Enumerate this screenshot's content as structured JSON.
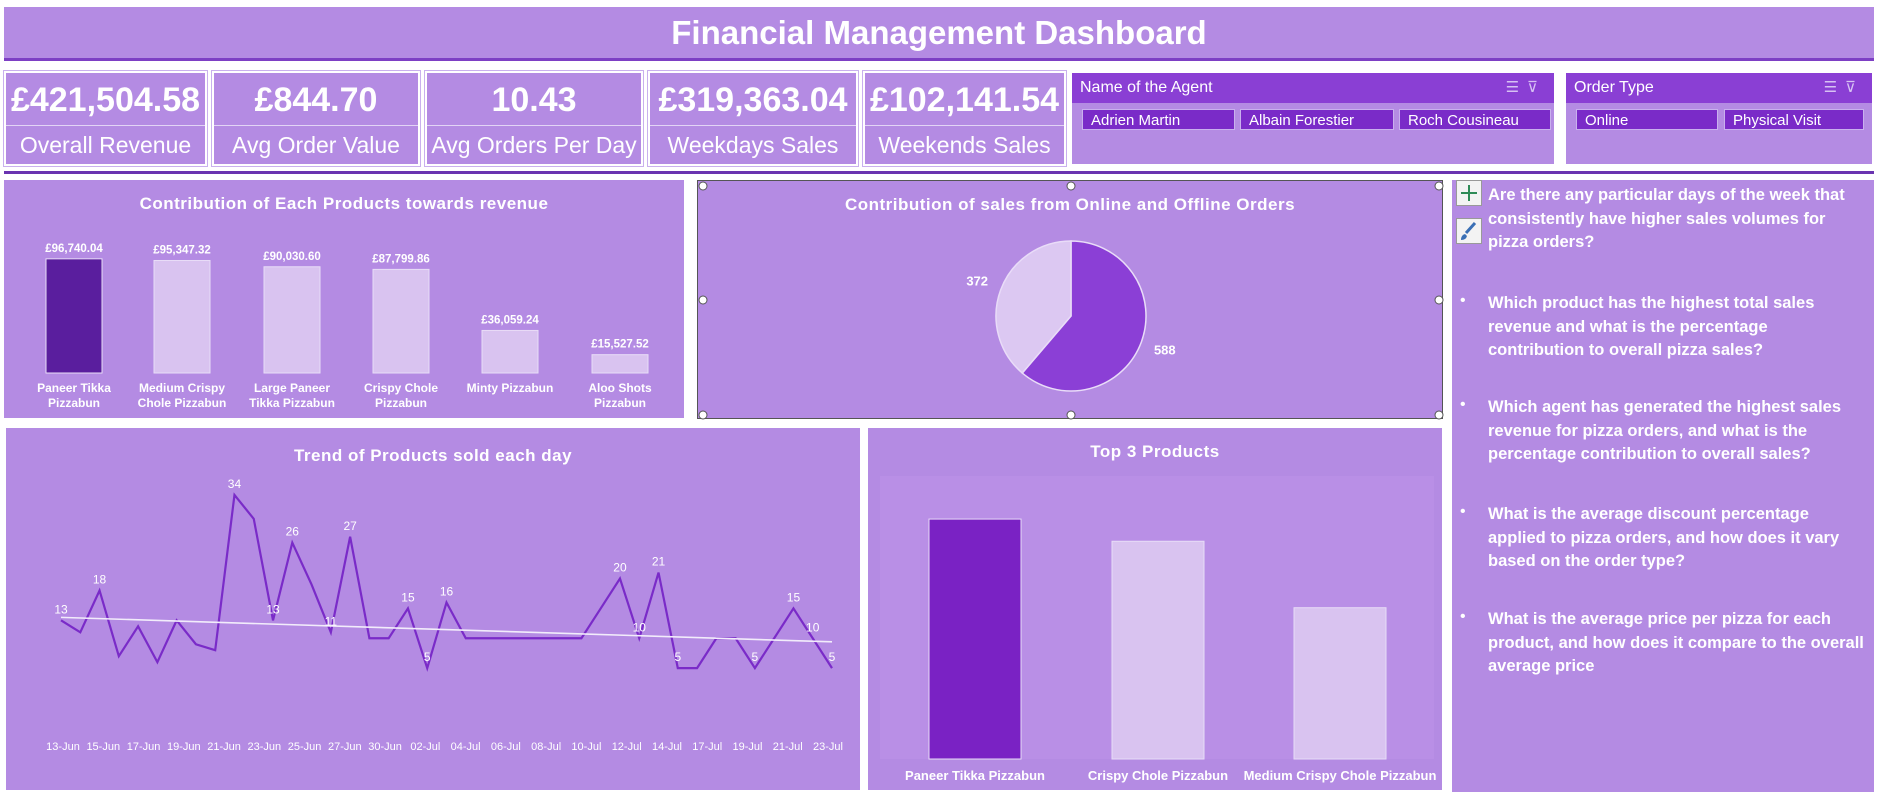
{
  "header": {
    "title": "Financial Management Dashboard"
  },
  "kpis": [
    {
      "value": "£421,504.58",
      "label": "Overall Revenue"
    },
    {
      "value": "£844.70",
      "label": "Avg Order Value"
    },
    {
      "value": "10.43",
      "label": "Avg Orders Per Day"
    },
    {
      "value": "£319,363.04",
      "label": "Weekdays Sales"
    },
    {
      "value": "£102,141.54",
      "label": "Weekends Sales"
    }
  ],
  "slicers": {
    "agent": {
      "title": "Name of the Agent",
      "items": [
        "Adrien Martin",
        "Albain Forestier",
        "Roch Cousineau"
      ]
    },
    "order_type": {
      "title": "Order Type",
      "items": [
        "Online",
        "Physical Visit"
      ]
    }
  },
  "colors": {
    "panel": "#b48be3",
    "accent": "#7a2bc8",
    "light_bar": "#d9c3f0",
    "dark_bar": "#5a1e9e"
  },
  "chart_data": [
    {
      "type": "bar",
      "title": "Contribution of Each Products towards revenue",
      "categories": [
        "Paneer Tikka Pizzabun",
        "Medium Crispy Chole Pizzabun",
        "Large Paneer Tikka Pizzabun",
        "Crispy Chole Pizzabun",
        "Minty Pizzabun",
        "Aloo Shots Pizzabun"
      ],
      "category_lines": [
        [
          "Paneer Tikka",
          "Pizzabun"
        ],
        [
          "Medium Crispy",
          "Chole Pizzabun"
        ],
        [
          "Large Paneer",
          "Tikka Pizzabun"
        ],
        [
          "Crispy Chole",
          "Pizzabun"
        ],
        [
          "Minty Pizzabun"
        ],
        [
          "Aloo Shots",
          "Pizzabun"
        ]
      ],
      "values": [
        96740.04,
        95347.32,
        90030.6,
        87799.86,
        36059.24,
        15527.52
      ],
      "data_labels": [
        "£96,740.04",
        "£95,347.32",
        "£90,030.60",
        "£87,799.86",
        "£36,059.24",
        "£15,527.52"
      ],
      "ylim": [
        0,
        100000
      ]
    },
    {
      "type": "pie",
      "title": "Contribution of sales from Online and Offline Orders",
      "values": [
        588,
        372
      ],
      "labels": [
        "588",
        "372"
      ]
    },
    {
      "type": "line",
      "title": "Trend of Products sold each day",
      "x_tick_labels": [
        "13-Jun",
        "15-Jun",
        "17-Jun",
        "19-Jun",
        "21-Jun",
        "23-Jun",
        "25-Jun",
        "27-Jun",
        "30-Jun",
        "02-Jul",
        "04-Jul",
        "06-Jul",
        "08-Jul",
        "10-Jul",
        "12-Jul",
        "14-Jul",
        "17-Jul",
        "19-Jul",
        "21-Jul",
        "23-Jul"
      ],
      "values": [
        13,
        11,
        18,
        7,
        12,
        6,
        13,
        9,
        8,
        34,
        30,
        13,
        26,
        19,
        11,
        27,
        10,
        10,
        15,
        5,
        16,
        10,
        10,
        10,
        10,
        10,
        10,
        10,
        15,
        20,
        10,
        21,
        5,
        5,
        10,
        10,
        5,
        10,
        15,
        10,
        5
      ],
      "labeled_points": [
        {
          "index": 0,
          "label": "13"
        },
        {
          "index": 2,
          "label": "18"
        },
        {
          "index": 9,
          "label": "34"
        },
        {
          "index": 11,
          "label": "13"
        },
        {
          "index": 12,
          "label": "26"
        },
        {
          "index": 14,
          "label": "11"
        },
        {
          "index": 15,
          "label": "27"
        },
        {
          "index": 18,
          "label": "15"
        },
        {
          "index": 19,
          "label": "5"
        },
        {
          "index": 20,
          "label": "16"
        },
        {
          "index": 29,
          "label": "20"
        },
        {
          "index": 30,
          "label": "10"
        },
        {
          "index": 31,
          "label": "21"
        },
        {
          "index": 32,
          "label": "5"
        },
        {
          "index": 36,
          "label": "5"
        },
        {
          "index": 38,
          "label": "15"
        },
        {
          "index": 39,
          "label": "10"
        },
        {
          "index": 40,
          "label": "5"
        }
      ],
      "trendline": {
        "start": 13.5,
        "end": 9.4
      },
      "ylim": [
        0,
        36
      ]
    },
    {
      "type": "bar",
      "title": "Top 3 Products",
      "categories": [
        "Paneer Tikka Pizzabun",
        "Crispy Chole Pizzabun",
        "Medium Crispy Chole Pizzabun"
      ],
      "values": [
        96740.04,
        87799.86,
        61000
      ],
      "ylim": [
        0,
        100000
      ]
    }
  ],
  "questions": [
    "Are there any particular days of the week that consistently have higher sales volumes for pizza orders?",
    "Which product has the highest total sales revenue and what is the percentage contribution to overall pizza sales?",
    "Which agent has generated the highest sales revenue for pizza orders, and what is the percentage contribution to overall sales?",
    "What is the average discount percentage applied to pizza orders, and how does it vary based on the order type?",
    "What is the average price per pizza for each product, and how does it compare to the overall average price"
  ],
  "bullet": "•"
}
